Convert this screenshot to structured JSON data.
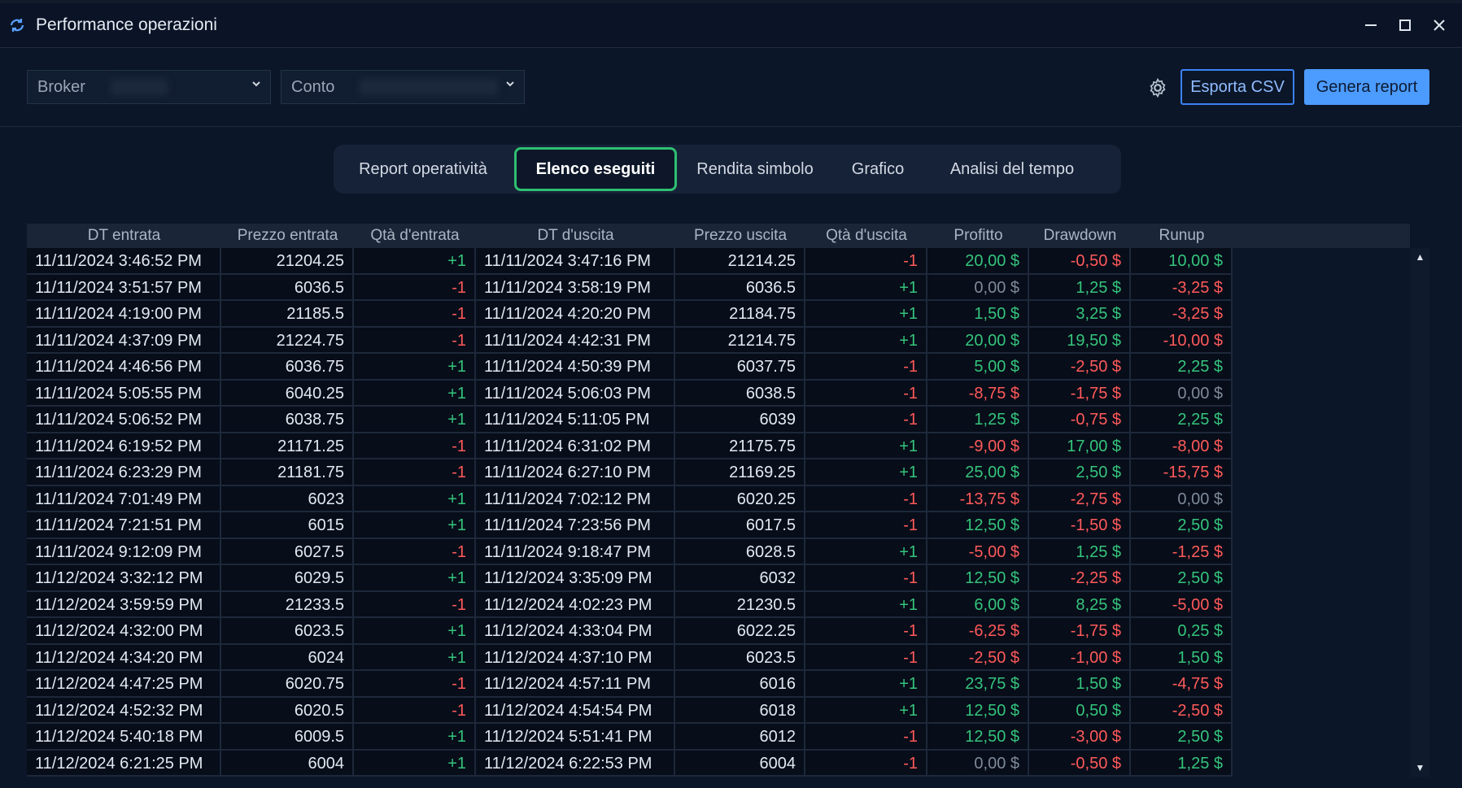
{
  "window": {
    "title": "Performance operazioni",
    "controls": {
      "minimize": "–",
      "maximize": "□",
      "close": "✕"
    }
  },
  "toolbar": {
    "broker": {
      "label": "Broker",
      "value": ""
    },
    "account": {
      "label": "Conto",
      "value": ""
    },
    "settings_icon": "gear-icon",
    "export_label": "Esporta CSV",
    "report_label": "Genera report"
  },
  "tabs": [
    {
      "label": "Report operatività",
      "active": false
    },
    {
      "label": "Elenco eseguiti",
      "active": true
    },
    {
      "label": "Rendita simbolo",
      "active": false
    },
    {
      "label": "Grafico",
      "active": false
    },
    {
      "label": "Analisi del tempo",
      "active": false
    }
  ],
  "table": {
    "columns": [
      "DT entrata",
      "Prezzo entrata",
      "Qtà d'entrata",
      "DT d'uscita",
      "Prezzo uscita",
      "Qtà d'uscita",
      "Profitto",
      "Drawdown",
      "Runup"
    ],
    "rows": [
      [
        "11/11/2024 3:46:52 PM",
        "21204.25",
        "+1",
        "11/11/2024 3:47:16 PM",
        "21214.25",
        "-1",
        "20,00 $",
        "-0,50 $",
        "10,00 $"
      ],
      [
        "11/11/2024 3:51:57 PM",
        "6036.5",
        "-1",
        "11/11/2024 3:58:19 PM",
        "6036.5",
        "+1",
        "0,00 $",
        "1,25 $",
        "-3,25 $"
      ],
      [
        "11/11/2024 4:19:00 PM",
        "21185.5",
        "-1",
        "11/11/2024 4:20:20 PM",
        "21184.75",
        "+1",
        "1,50 $",
        "3,25 $",
        "-3,25 $"
      ],
      [
        "11/11/2024 4:37:09 PM",
        "21224.75",
        "-1",
        "11/11/2024 4:42:31 PM",
        "21214.75",
        "+1",
        "20,00 $",
        "19,50 $",
        "-10,00 $"
      ],
      [
        "11/11/2024 4:46:56 PM",
        "6036.75",
        "+1",
        "11/11/2024 4:50:39 PM",
        "6037.75",
        "-1",
        "5,00 $",
        "-2,50 $",
        "2,25 $"
      ],
      [
        "11/11/2024 5:05:55 PM",
        "6040.25",
        "+1",
        "11/11/2024 5:06:03 PM",
        "6038.5",
        "-1",
        "-8,75 $",
        "-1,75 $",
        "0,00 $"
      ],
      [
        "11/11/2024 5:06:52 PM",
        "6038.75",
        "+1",
        "11/11/2024 5:11:05 PM",
        "6039",
        "-1",
        "1,25 $",
        "-0,75 $",
        "2,25 $"
      ],
      [
        "11/11/2024 6:19:52 PM",
        "21171.25",
        "-1",
        "11/11/2024 6:31:02 PM",
        "21175.75",
        "+1",
        "-9,00 $",
        "17,00 $",
        "-8,00 $"
      ],
      [
        "11/11/2024 6:23:29 PM",
        "21181.75",
        "-1",
        "11/11/2024 6:27:10 PM",
        "21169.25",
        "+1",
        "25,00 $",
        "2,50 $",
        "-15,75 $"
      ],
      [
        "11/11/2024 7:01:49 PM",
        "6023",
        "+1",
        "11/11/2024 7:02:12 PM",
        "6020.25",
        "-1",
        "-13,75 $",
        "-2,75 $",
        "0,00 $"
      ],
      [
        "11/11/2024 7:21:51 PM",
        "6015",
        "+1",
        "11/11/2024 7:23:56 PM",
        "6017.5",
        "-1",
        "12,50 $",
        "-1,50 $",
        "2,50 $"
      ],
      [
        "11/11/2024 9:12:09 PM",
        "6027.5",
        "-1",
        "11/11/2024 9:18:47 PM",
        "6028.5",
        "+1",
        "-5,00 $",
        "1,25 $",
        "-1,25 $"
      ],
      [
        "11/12/2024 3:32:12 PM",
        "6029.5",
        "+1",
        "11/12/2024 3:35:09 PM",
        "6032",
        "-1",
        "12,50 $",
        "-2,25 $",
        "2,50 $"
      ],
      [
        "11/12/2024 3:59:59 PM",
        "21233.5",
        "-1",
        "11/12/2024 4:02:23 PM",
        "21230.5",
        "+1",
        "6,00 $",
        "8,25 $",
        "-5,00 $"
      ],
      [
        "11/12/2024 4:32:00 PM",
        "6023.5",
        "+1",
        "11/12/2024 4:33:04 PM",
        "6022.25",
        "-1",
        "-6,25 $",
        "-1,75 $",
        "0,25 $"
      ],
      [
        "11/12/2024 4:34:20 PM",
        "6024",
        "+1",
        "11/12/2024 4:37:10 PM",
        "6023.5",
        "-1",
        "-2,50 $",
        "-1,00 $",
        "1,50 $"
      ],
      [
        "11/12/2024 4:47:25 PM",
        "6020.75",
        "-1",
        "11/12/2024 4:57:11 PM",
        "6016",
        "+1",
        "23,75 $",
        "1,50 $",
        "-4,75 $"
      ],
      [
        "11/12/2024 4:52:32 PM",
        "6020.5",
        "-1",
        "11/12/2024 4:54:54 PM",
        "6018",
        "+1",
        "12,50 $",
        "0,50 $",
        "-2,50 $"
      ],
      [
        "11/12/2024 5:40:18 PM",
        "6009.5",
        "+1",
        "11/12/2024 5:51:41 PM",
        "6012",
        "-1",
        "12,50 $",
        "-3,00 $",
        "2,50 $"
      ],
      [
        "11/12/2024 6:21:25 PM",
        "6004",
        "+1",
        "11/12/2024 6:22:53 PM",
        "6004",
        "-1",
        "0,00 $",
        "-0,50 $",
        "1,25 $"
      ]
    ]
  },
  "colors": {
    "positive": "#35c47c",
    "negative": "#ff5a5a",
    "zero": "#7f8a99",
    "accent": "#3b82f6",
    "tab_active_border": "#2fbf71"
  }
}
